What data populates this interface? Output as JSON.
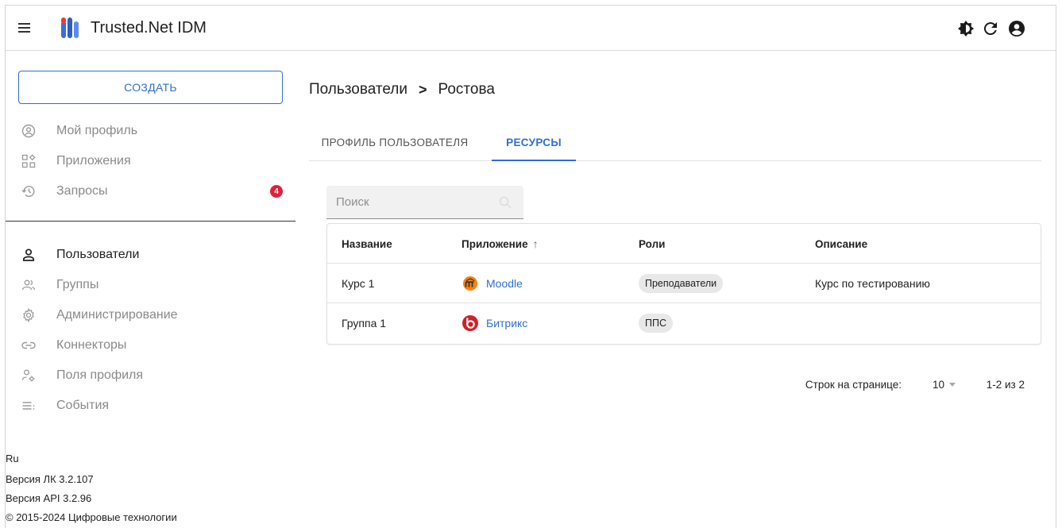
{
  "header": {
    "app_title": "Trusted.Net IDM",
    "icons": [
      "theme-toggle-icon",
      "refresh-icon",
      "account-icon"
    ]
  },
  "sidebar": {
    "create_label": "СОЗДАТЬ",
    "items": [
      {
        "label": "Мой профиль",
        "icon": "profile-circle-icon"
      },
      {
        "label": "Приложения",
        "icon": "apps-icon"
      },
      {
        "label": "Запросы",
        "icon": "history-icon",
        "badge": "4"
      },
      {
        "label": "Пользователи",
        "icon": "user-icon",
        "active": true
      },
      {
        "label": "Группы",
        "icon": "group-icon"
      },
      {
        "label": "Администрирование",
        "icon": "settings-gear-icon"
      },
      {
        "label": "Коннекторы",
        "icon": "link-icon"
      },
      {
        "label": "Поля профиля",
        "icon": "user-settings-icon"
      },
      {
        "label": "События",
        "icon": "events-list-icon"
      }
    ],
    "footer": {
      "language": "Ru",
      "version_lk": "Версия ЛК 3.2.107",
      "version_api": "Версия API 3.2.96",
      "copyright": "© 2015-2024 Цифровые технологии"
    }
  },
  "main": {
    "breadcrumb": {
      "parent": "Пользователи",
      "separator": ">",
      "current": "Ростова"
    },
    "tabs": [
      {
        "label": "ПРОФИЛЬ ПОЛЬЗОВАТЕЛЯ",
        "active": false
      },
      {
        "label": "РЕСУРСЫ",
        "active": true
      }
    ],
    "search": {
      "placeholder": "Поиск",
      "value": ""
    },
    "table": {
      "columns": [
        "Название",
        "Приложение",
        "Роли",
        "Описание"
      ],
      "sort_indicator": "↑",
      "rows": [
        {
          "name": "Курс 1",
          "app": "Moodle",
          "app_icon": "moodle-icon",
          "role": "Преподаватели",
          "description": "Курс по тестированию"
        },
        {
          "name": "Группа 1",
          "app": "Битрикс",
          "app_icon": "bitrix-icon",
          "role": "ППС",
          "description": ""
        }
      ]
    },
    "pagination": {
      "rows_per_page_label": "Строк на странице:",
      "rows_per_page_value": "10",
      "range": "1-2 из 2"
    }
  },
  "colors": {
    "accent": "#2f6fd3",
    "badge": "#e0213b",
    "muted_text": "#8a8a8a"
  }
}
